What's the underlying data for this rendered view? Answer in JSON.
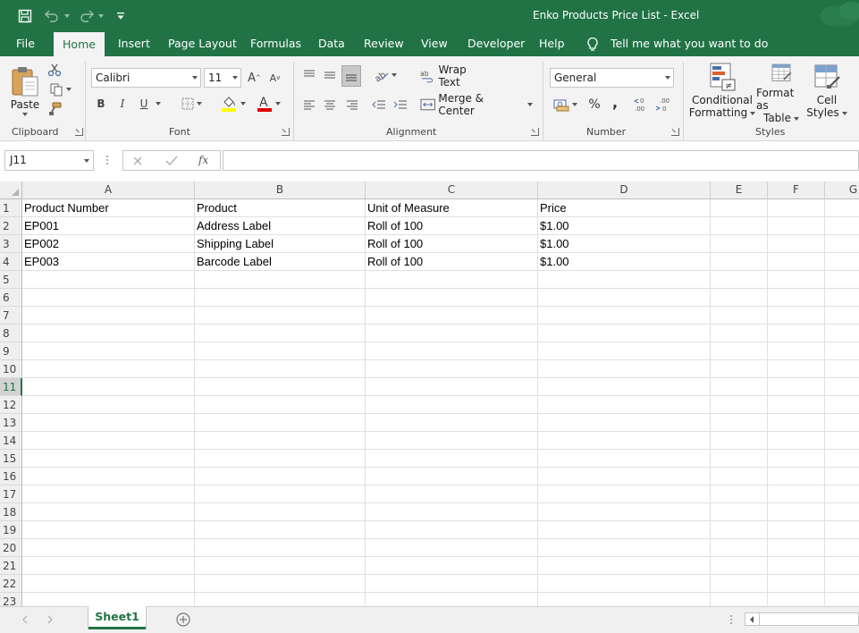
{
  "window": {
    "title": "Enko Products Price List  -  Excel"
  },
  "menu": {
    "tabs": [
      "File",
      "Home",
      "Insert",
      "Page Layout",
      "Formulas",
      "Data",
      "Review",
      "View",
      "Developer",
      "Help"
    ],
    "active": "Home",
    "tell_me": "Tell me what you want to do"
  },
  "ribbon": {
    "clipboard": {
      "paste": "Paste",
      "label": "Clipboard"
    },
    "font": {
      "name": "Calibri",
      "size": "11",
      "bold": "B",
      "italic": "I",
      "underline": "U",
      "label": "Font"
    },
    "alignment": {
      "wrap_text": "Wrap Text",
      "merge_center": "Merge & Center",
      "label": "Alignment"
    },
    "number": {
      "format": "General",
      "percent": "%",
      "comma": ",",
      "label": "Number"
    },
    "styles": {
      "conditional_1": "Conditional",
      "conditional_2": "Formatting",
      "format_table_1": "Format as",
      "format_table_2": "Table",
      "cell_styles_1": "Cell",
      "cell_styles_2": "Styles",
      "label": "Styles"
    }
  },
  "formula_bar": {
    "name_box": "J11",
    "fx": "fx",
    "value": ""
  },
  "sheet": {
    "columns": [
      "A",
      "B",
      "C",
      "D",
      "E",
      "F",
      "G"
    ],
    "selected_row": 11,
    "rows": [
      [
        "Product Number",
        "Product",
        "Unit of Measure",
        "Price"
      ],
      [
        "EP001",
        "Address Label",
        "Roll of 100",
        "$1.00"
      ],
      [
        "EP002",
        "Shipping Label",
        "Roll of 100",
        "$1.00"
      ],
      [
        "EP003",
        "Barcode Label",
        "Roll of 100",
        "$1.00"
      ]
    ],
    "row_count": 23
  },
  "sheet_tabs": {
    "tabs": [
      "Sheet1"
    ],
    "active": "Sheet1"
  }
}
